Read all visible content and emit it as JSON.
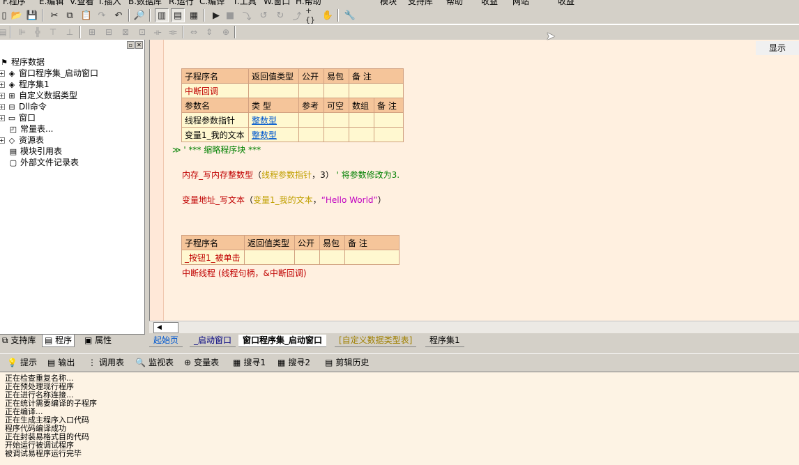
{
  "menubar": [
    "F.程序",
    "E.编辑",
    "V.查看",
    "I.插入",
    "B.数据库",
    "R.运行",
    "C.编译",
    "T.工具",
    "W.窗口",
    "H.帮助",
    "模块",
    "支持库",
    "帮助",
    "收益",
    "网站",
    "收益"
  ],
  "icons": {
    "toolbar1": [
      "new-file-icon",
      "open-folder-icon",
      "save-icon",
      "cut-icon",
      "copy-icon",
      "paste-icon",
      "redo-icon",
      "undo-icon",
      "find-icon",
      "layout-1-icon",
      "layout-2-icon",
      "layout-3-icon",
      "run-icon",
      "stop-icon",
      "step-into-icon",
      "step-over-icon",
      "step-out-icon",
      "run-to-cursor-icon",
      "watch-icon",
      "hand-icon",
      "wizard-icon"
    ]
  },
  "sidebar": {
    "tree": [
      {
        "label": "程序数据",
        "icon": "⚑"
      },
      {
        "label": "窗口程序集_启动窗口",
        "icon": "◈"
      },
      {
        "label": "程序集1",
        "icon": "◈"
      },
      {
        "label": "自定义数据类型",
        "icon": "⊞"
      },
      {
        "label": "Dll命令",
        "icon": "⊟"
      },
      {
        "label": "窗口",
        "icon": "▭"
      },
      {
        "label": "常量表...",
        "icon": "◰"
      },
      {
        "label": "资源表",
        "icon": "◇"
      },
      {
        "label": "模块引用表",
        "icon": "▤"
      },
      {
        "label": "外部文件记录表",
        "icon": "▢"
      }
    ],
    "tabs": [
      "支持库",
      "程序",
      "属性"
    ]
  },
  "editor": {
    "show_button": "显示",
    "table1": {
      "header": [
        "子程序名",
        "返回值类型",
        "公开",
        "易包",
        "备 注"
      ],
      "row": [
        "中断回调",
        "",
        "",
        "",
        ""
      ],
      "param_header": [
        "参数名",
        "类 型",
        "参考",
        "可空",
        "数组",
        "备 注"
      ],
      "params": [
        [
          "线程参数指针",
          "整数型",
          "",
          "",
          "",
          ""
        ],
        [
          "变量1_我的文本",
          "整数型",
          "",
          "",
          "",
          ""
        ]
      ]
    },
    "fold_line": "≫ ' *** 缩略程序块 ***",
    "code1": {
      "fn": "内存_写内存整数型",
      "open": "（",
      "arg1": "线程参数指针",
      "sep": "，",
      "arg2": "3",
      "close": "）",
      "comment": "' 将参数修改为3."
    },
    "code2": {
      "fn": "变量地址_写文本",
      "open": "（",
      "arg1": "变量1_我的文本",
      "sep": "，",
      "arg2": "“Hello World”",
      "close": "）"
    },
    "table2": {
      "header": [
        "子程序名",
        "返回值类型",
        "公开",
        "易包",
        "备 注"
      ],
      "row": [
        "_按钮1_被单击",
        "",
        "",
        "",
        ""
      ]
    },
    "code3": "中断线程 (线程句柄，&中断回调)",
    "tabs": [
      "起始页",
      "_启动窗口",
      "窗口程序集_启动窗口",
      "[自定义数据类型表]",
      "程序集1"
    ]
  },
  "bottom": {
    "tabs": [
      {
        "label": "提示",
        "icon": "💡"
      },
      {
        "label": "输出",
        "icon": "▤"
      },
      {
        "label": "调用表",
        "icon": "⋮"
      },
      {
        "label": "监视表",
        "icon": "🔍"
      },
      {
        "label": "变量表",
        "icon": "⊕"
      },
      {
        "label": "搜寻1",
        "icon": "▦"
      },
      {
        "label": "搜寻2",
        "icon": "▦"
      },
      {
        "label": "剪辑历史",
        "icon": "▤"
      }
    ],
    "output": [
      "正在检查重复名称...",
      "正在预处理现行程序",
      "正在进行名称连接...",
      "正在统计需要编译的子程序",
      "正在编译...",
      "正在生成主程序入口代码",
      "程序代码编译成功",
      "正在封装易格式目的代码",
      "开始运行被调试程序",
      "被调试易程序运行完毕"
    ]
  }
}
